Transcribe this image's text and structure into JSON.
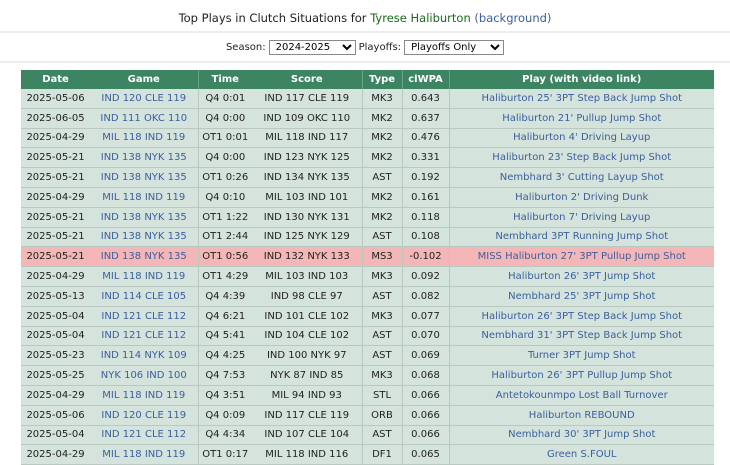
{
  "title": {
    "prefix": "Top Plays in Clutch Situations for",
    "player": "Tyrese Haliburton",
    "paren_open": "(",
    "link": "background",
    "paren_close": ")"
  },
  "filters": {
    "season_label": "Season:",
    "season_value": "2024-2025",
    "playoffs_label": "Playoffs:",
    "playoffs_value": "Playoffs Only"
  },
  "columns": [
    "Date",
    "Game",
    "Time",
    "Score",
    "Type",
    "clWPA",
    "Play (with video link)"
  ],
  "rows": [
    [
      "2025-05-06",
      "IND 120 CLE 119",
      "Q4 0:01",
      "IND 117 CLE 119",
      "MK3",
      "0.643",
      "Haliburton 25' 3PT Step Back Jump Shot"
    ],
    [
      "2025-06-05",
      "IND 111 OKC 110",
      "Q4 0:00",
      "IND 109 OKC 110",
      "MK2",
      "0.637",
      "Haliburton 21' Pullup Jump Shot"
    ],
    [
      "2025-04-29",
      "MIL 118 IND 119",
      "OT1 0:01",
      "MIL 118 IND 117",
      "MK2",
      "0.476",
      "Haliburton 4' Driving Layup"
    ],
    [
      "2025-05-21",
      "IND 138 NYK 135",
      "Q4 0:00",
      "IND 123 NYK 125",
      "MK2",
      "0.331",
      "Haliburton 23' Step Back Jump Shot"
    ],
    [
      "2025-05-21",
      "IND 138 NYK 135",
      "OT1 0:26",
      "IND 134 NYK 135",
      "AST",
      "0.192",
      "Nembhard 3' Cutting Layup Shot"
    ],
    [
      "2025-04-29",
      "MIL 118 IND 119",
      "Q4 0:10",
      "MIL 103 IND 101",
      "MK2",
      "0.161",
      "Haliburton 2' Driving Dunk"
    ],
    [
      "2025-05-21",
      "IND 138 NYK 135",
      "OT1 1:22",
      "IND 130 NYK 131",
      "MK2",
      "0.118",
      "Haliburton 7' Driving Layup"
    ],
    [
      "2025-05-21",
      "IND 138 NYK 135",
      "OT1 2:44",
      "IND 125 NYK 129",
      "AST",
      "0.108",
      "Nembhard 3PT Running Jump Shot"
    ],
    [
      "2025-05-21",
      "IND 138 NYK 135",
      "OT1 0:56",
      "IND 132 NYK 133",
      "MS3",
      "-0.102",
      "MISS Haliburton 27' 3PT Pullup Jump Shot"
    ],
    [
      "2025-04-29",
      "MIL 118 IND 119",
      "OT1 4:29",
      "MIL 103 IND 103",
      "MK3",
      "0.092",
      "Haliburton 26' 3PT Jump Shot"
    ],
    [
      "2025-05-13",
      "IND 114 CLE 105",
      "Q4 4:39",
      "IND 98 CLE 97",
      "AST",
      "0.082",
      "Nembhard 25' 3PT Jump Shot"
    ],
    [
      "2025-05-04",
      "IND 121 CLE 112",
      "Q4 6:21",
      "IND 101 CLE 102",
      "MK3",
      "0.077",
      "Haliburton 26' 3PT Step Back Jump Shot"
    ],
    [
      "2025-05-04",
      "IND 121 CLE 112",
      "Q4 5:41",
      "IND 104 CLE 102",
      "AST",
      "0.070",
      "Nembhard 31' 3PT Step Back Jump Shot"
    ],
    [
      "2025-05-23",
      "IND 114 NYK 109",
      "Q4 4:25",
      "IND 100 NYK 97",
      "AST",
      "0.069",
      "Turner 3PT Jump Shot"
    ],
    [
      "2025-05-25",
      "NYK 106 IND 100",
      "Q4 7:53",
      "NYK 87 IND 85",
      "MK3",
      "0.068",
      "Haliburton 26' 3PT Pullup Jump Shot"
    ],
    [
      "2025-04-29",
      "MIL 118 IND 119",
      "Q4 3:51",
      "MIL 94 IND 93",
      "STL",
      "0.066",
      "Antetokounmpo Lost Ball Turnover"
    ],
    [
      "2025-05-06",
      "IND 120 CLE 119",
      "Q4 0:09",
      "IND 117 CLE 119",
      "ORB",
      "0.066",
      "Haliburton REBOUND"
    ],
    [
      "2025-05-04",
      "IND 121 CLE 112",
      "Q4 4:34",
      "IND 107 CLE 104",
      "AST",
      "0.066",
      "Nembhard 30' 3PT Jump Shot"
    ],
    [
      "2025-04-29",
      "MIL 118 IND 119",
      "OT1 0:17",
      "MIL 118 IND 116",
      "DF1",
      "0.065",
      "Green S.FOUL"
    ]
  ],
  "colors": {
    "header": "#3d8562",
    "row": "#d5e3dd",
    "negative_row": "#f4b6b6",
    "link": "#3b5f9e",
    "player": "#1a6b1a"
  }
}
